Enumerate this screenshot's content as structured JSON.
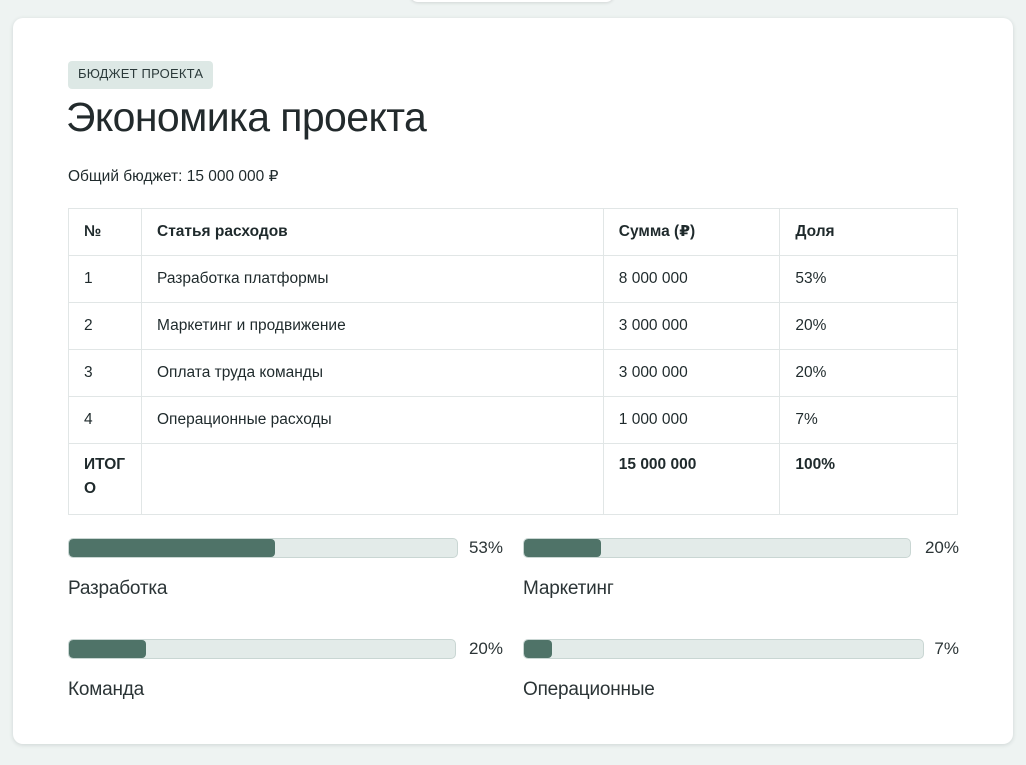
{
  "header": {
    "badge": "БЮДЖЕТ ПРОЕКТА",
    "title": "Экономика проекта",
    "budget_line": "Общий бюджет: 15 000 000 ₽"
  },
  "table": {
    "headers": [
      "№",
      "Статья расходов",
      "Сумма (₽)",
      "Доля"
    ],
    "rows": [
      {
        "num": "1",
        "item": "Разработка платформы",
        "sum": "8 000 000",
        "share": "53%"
      },
      {
        "num": "2",
        "item": "Маркетинг и продвижение",
        "sum": "3 000 000",
        "share": "20%"
      },
      {
        "num": "3",
        "item": "Оплата труда команды",
        "sum": "3 000 000",
        "share": "20%"
      },
      {
        "num": "4",
        "item": "Операционные расходы",
        "sum": "1 000 000",
        "share": "7%"
      }
    ],
    "total": {
      "label": "ИТОГО",
      "sum": "15 000 000",
      "share": "100%"
    }
  },
  "bars": [
    {
      "label": "Разработка",
      "pct_text": "53%",
      "value": 0.53
    },
    {
      "label": "Маркетинг",
      "pct_text": "20%",
      "value": 0.2
    },
    {
      "label": "Команда",
      "pct_text": "20%",
      "value": 0.2
    },
    {
      "label": "Операционные",
      "pct_text": "7%",
      "value": 0.07
    }
  ],
  "colors": {
    "accent": "#4f7368",
    "track": "#e3ebe9",
    "badge_bg": "#dde8e5",
    "page_bg": "#eef3f2"
  }
}
